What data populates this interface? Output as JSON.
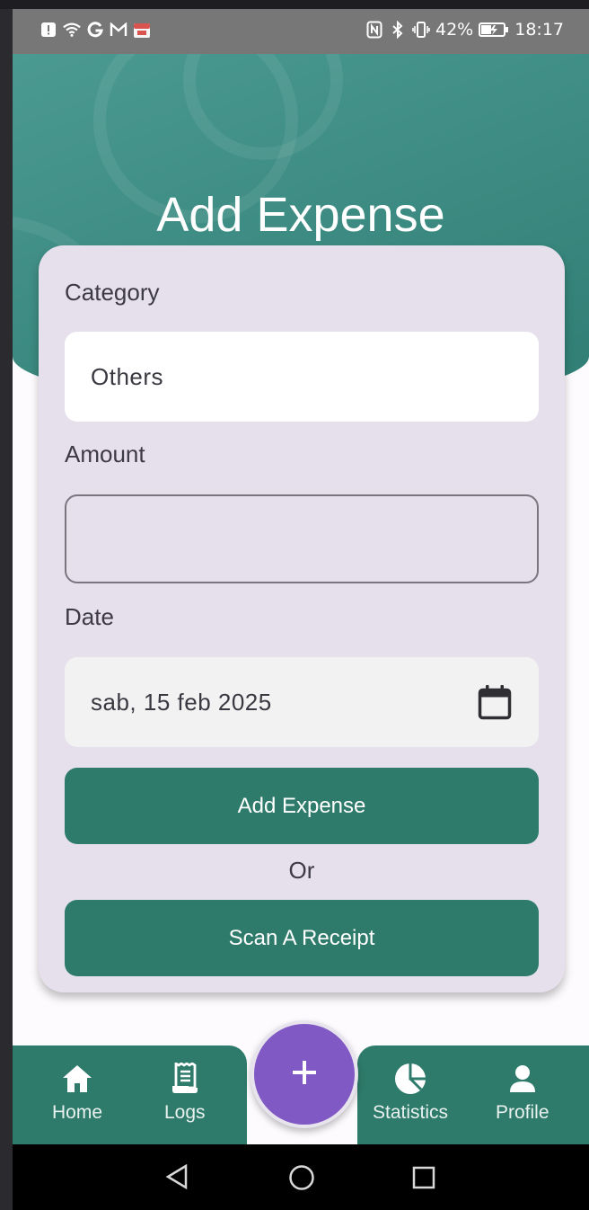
{
  "status_bar": {
    "battery": "42%",
    "time": "18:17",
    "icons_left": [
      "alert-icon",
      "wifi-icon",
      "google-icon",
      "gmail-icon",
      "calendar-app-icon"
    ],
    "icons_right": [
      "nfc-icon",
      "bluetooth-icon",
      "vibrate-icon",
      "battery-icon"
    ]
  },
  "header": {
    "title": "Add Expense"
  },
  "form": {
    "category": {
      "label": "Category",
      "value": "Others"
    },
    "amount": {
      "label": "Amount",
      "value": ""
    },
    "date": {
      "label": "Date",
      "value": "sab, 15 feb 2025"
    },
    "add_button": "Add Expense",
    "or_text": "Or",
    "scan_button": "Scan A Receipt"
  },
  "bottom_nav": {
    "items": [
      {
        "label": "Home",
        "icon": "home-icon"
      },
      {
        "label": "Logs",
        "icon": "receipt-icon"
      },
      {
        "label": "Statistics",
        "icon": "pie-chart-icon"
      },
      {
        "label": "Profile",
        "icon": "person-icon"
      }
    ],
    "fab_icon": "plus-icon"
  },
  "colors": {
    "primary": "#2e7b6b",
    "header": "#3a8a80",
    "fab": "#8059c4",
    "card": "#e6dfec"
  }
}
